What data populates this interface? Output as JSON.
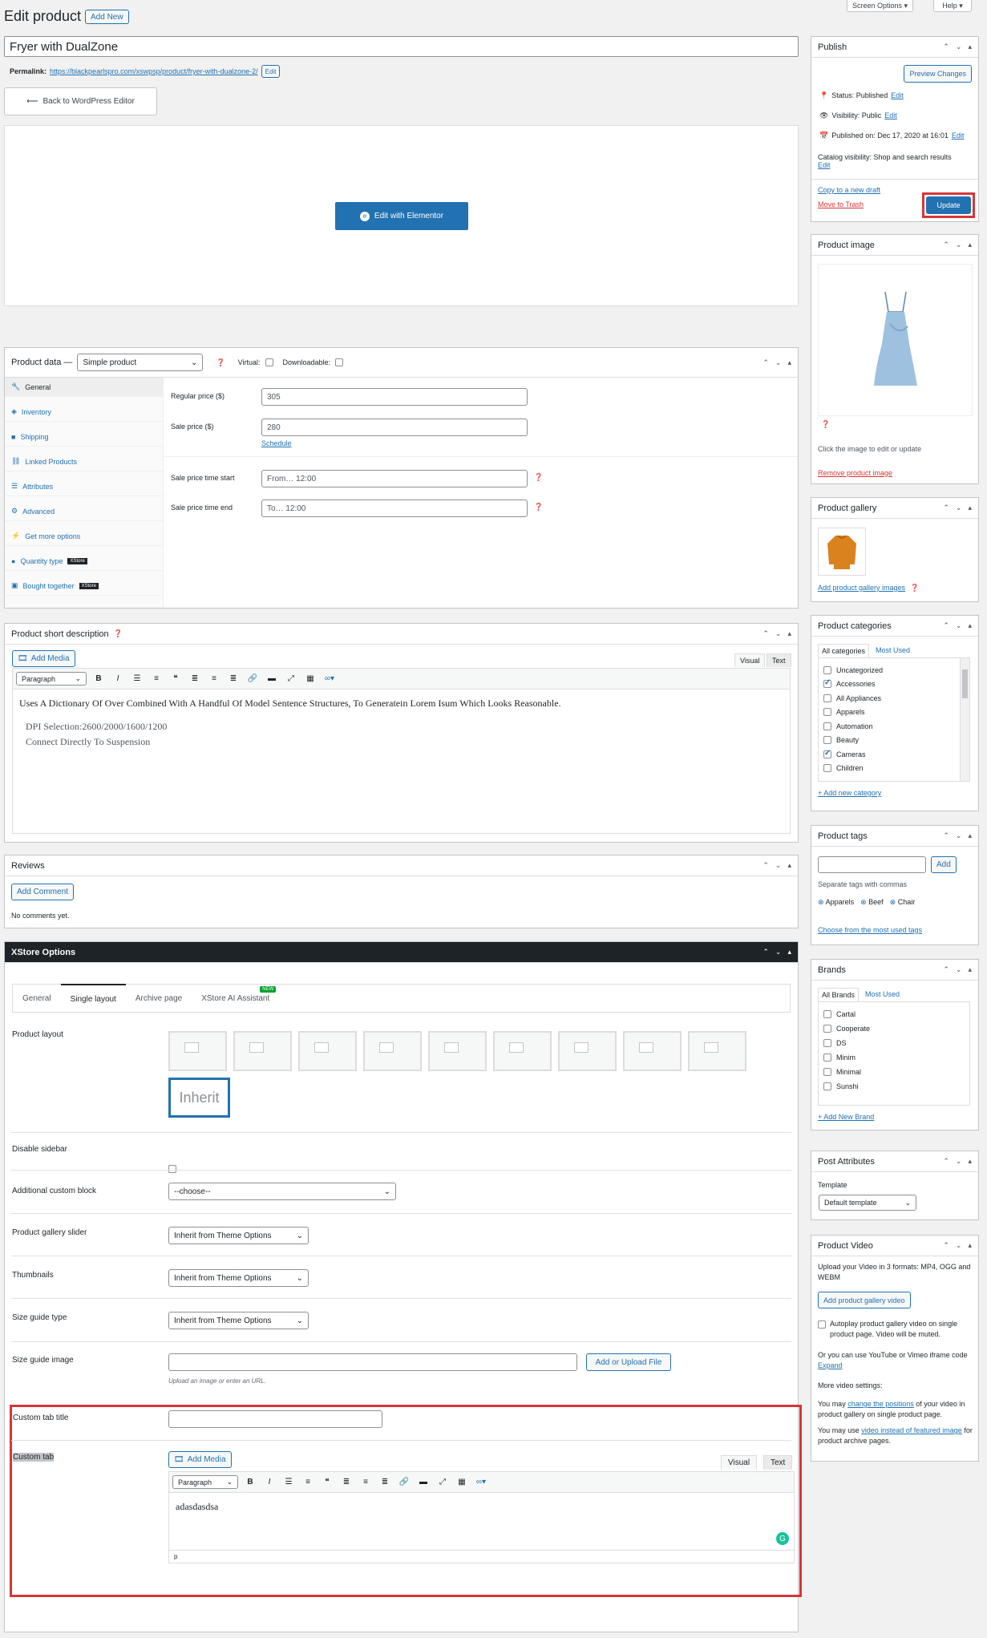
{
  "header": {
    "title": "Edit product",
    "add_new": "Add New",
    "screen_options": "Screen Options ▾",
    "help": "Help ▾"
  },
  "post": {
    "title_value": "Fryer with DualZone",
    "permalink_label": "Permalink:",
    "permalink_url": "https://blackpearlspro.com/xswpsp/product/fryer-with-dualzone-2/",
    "permalink_edit": "Edit",
    "back_to_editor": "Back to WordPress Editor",
    "edit_with_elementor": "Edit with Elementor"
  },
  "publish": {
    "title": "Publish",
    "preview": "Preview Changes",
    "status_label": "Status: Published",
    "visibility_label": "Visibility: Public",
    "published_on": "Published on: Dec 17, 2020 at 16:01",
    "edit": "Edit",
    "catalog_visibility": "Catalog visibility: Shop and search results",
    "copy_draft": "Copy to a new draft",
    "trash": "Move to Trash",
    "update": "Update"
  },
  "product_image": {
    "title": "Product image",
    "hint": "Click the image to edit or update",
    "remove": "Remove product image"
  },
  "gallery": {
    "title": "Product gallery",
    "add": "Add product gallery images"
  },
  "categories": {
    "title": "Product categories",
    "tab_all": "All categories",
    "tab_used": "Most Used",
    "items": [
      {
        "label": "Uncategorized",
        "checked": false
      },
      {
        "label": "Accessories",
        "checked": true
      },
      {
        "label": "All Appliances",
        "checked": false
      },
      {
        "label": "Apparels",
        "checked": false
      },
      {
        "label": "Automation",
        "checked": false
      },
      {
        "label": "Beauty",
        "checked": false
      },
      {
        "label": "Cameras",
        "checked": true
      },
      {
        "label": "Children",
        "checked": false
      }
    ],
    "add_new": "+ Add new category"
  },
  "tags": {
    "title": "Product tags",
    "add": "Add",
    "hint": "Separate tags with commas",
    "items": [
      "Apparels",
      "Beef",
      "Chair"
    ],
    "choose": "Choose from the most used tags"
  },
  "brands": {
    "title": "Brands",
    "tab_all": "All Brands",
    "tab_used": "Most Used",
    "items": [
      "Cartal",
      "Cooperate",
      "DS",
      "Minim",
      "Minimal",
      "Sunshi"
    ],
    "add_new": "+ Add New Brand"
  },
  "post_attributes": {
    "title": "Post Attributes",
    "template_label": "Template",
    "template_value": "Default template"
  },
  "product_video": {
    "title": "Product Video",
    "upload_text": "Upload your Video in 3 formats: MP4, OGG and WEBM",
    "add_button": "Add product gallery video",
    "autoplay": "Autoplay product gallery video on single product page. Video will be muted.",
    "or_text": "Or you can use YouTube or Vimeo iframe code",
    "expand": "Expand",
    "more_settings": "More video settings:",
    "may1_a": "You may",
    "may1_link": "change the positions",
    "may1_b": "of your video in product gallery on single product page.",
    "may2_a": "You may use",
    "may2_link": "video instead of featured image",
    "may2_b": "for product archive pages."
  },
  "product_data": {
    "title": "Product data —",
    "type": "Simple product",
    "virtual": "Virtual:",
    "downloadable": "Downloadable:",
    "tabs": [
      "General",
      "Inventory",
      "Shipping",
      "Linked Products",
      "Attributes",
      "Advanced",
      "Get more options",
      "Quantity type",
      "Bought together"
    ],
    "xstore_badge": "XStore",
    "regular_price_label": "Regular price ($)",
    "regular_price": "305",
    "sale_price_label": "Sale price ($)",
    "sale_price": "280",
    "schedule": "Schedule",
    "start_label": "Sale price time start",
    "start_placeholder": "From… 12:00",
    "end_label": "Sale price time end",
    "end_placeholder": "To… 12:00"
  },
  "short_desc": {
    "title": "Product short description",
    "add_media": "Add Media",
    "tab_visual": "Visual",
    "tab_text": "Text",
    "format": "Paragraph",
    "line1": "Uses A Dictionary Of Over Combined With A Handful Of Model Sentence Structures, To Generatein Lorem Isum Which Looks Reasonable.",
    "line2": "DPI Selection:2600/2000/1600/1200",
    "line3": "Connect Directly To Suspension"
  },
  "reviews": {
    "title": "Reviews",
    "add_comment": "Add Comment",
    "none": "No comments yet."
  },
  "xstore": {
    "title": "XStore Options",
    "tabs": [
      "General",
      "Single layout",
      "Archive page",
      "XStore AI Assistant"
    ],
    "new_badge": "NEW",
    "product_layout": "Product layout",
    "inherit": "Inherit",
    "disable_sidebar": "Disable sidebar",
    "custom_block": "Additional custom block",
    "custom_block_value": "--choose--",
    "gallery_slider": "Product gallery slider",
    "thumbnails": "Thumbnails",
    "size_guide_type": "Size guide type",
    "inherit_opt": "Inherit from Theme Options",
    "size_guide_image": "Size guide image",
    "upload_btn": "Add or Upload File",
    "upload_hint": "Upload an image or enter an URL.",
    "custom_tab_title": "Custom tab title",
    "custom_tab": "Custom tab",
    "add_media": "Add Media",
    "tab_visual": "Visual",
    "tab_text": "Text",
    "format": "Paragraph",
    "content": "adasdasdsa",
    "path": "p"
  },
  "colors": {
    "accent": "#2271b1",
    "highlight": "#d63638",
    "dark_bar": "#1d2327"
  }
}
